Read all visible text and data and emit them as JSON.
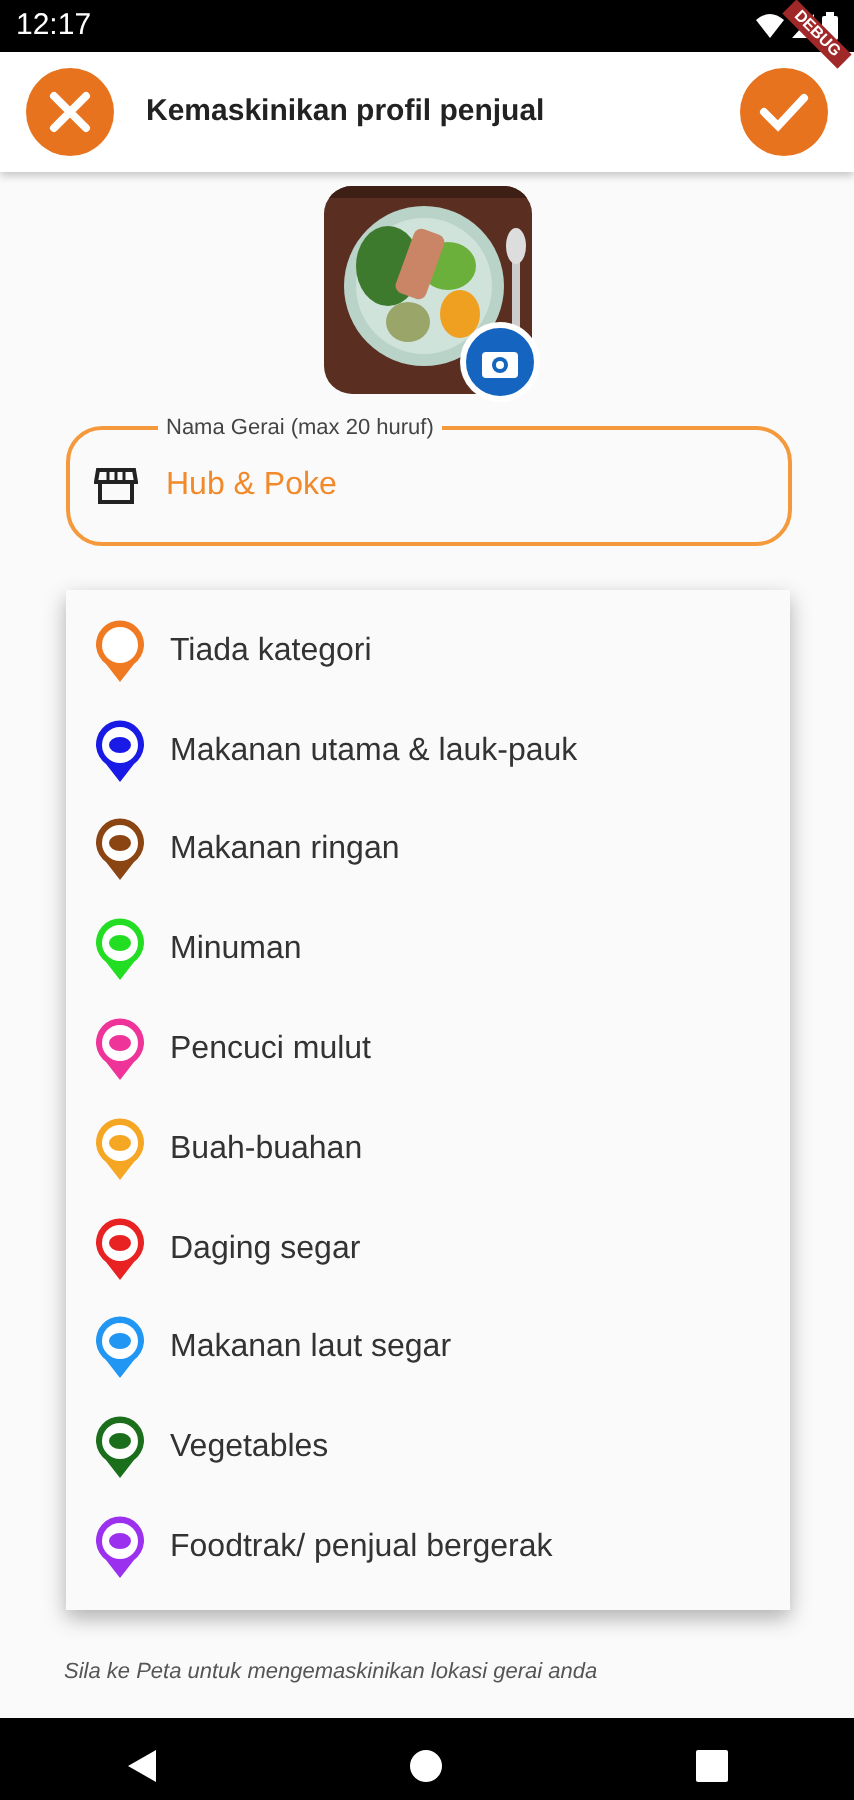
{
  "status_bar": {
    "time": "12:17"
  },
  "debug_banner": "DEBUG",
  "app_bar": {
    "title": "Kemaskinikan profil penjual"
  },
  "name_field": {
    "label": "Nama Gerai (max 20 huruf)",
    "value": "Hub & Poke"
  },
  "category_menu": [
    {
      "label": "Tiada kategori",
      "color": "#f07a22"
    },
    {
      "label": "Makanan utama & lauk-pauk",
      "color": "#1a1ae6"
    },
    {
      "label": "Makanan ringan",
      "color": "#8b4513"
    },
    {
      "label": "Minuman",
      "color": "#22dd22"
    },
    {
      "label": "Pencuci mulut",
      "color": "#ee3399"
    },
    {
      "label": "Buah-buahan",
      "color": "#f5a623"
    },
    {
      "label": "Daging segar",
      "color": "#e82222"
    },
    {
      "label": "Makanan laut segar",
      "color": "#2196f3"
    },
    {
      "label": "Vegetables",
      "color": "#1b6e1b"
    },
    {
      "label": "Foodtrak/ penjual bergerak",
      "color": "#9b30ef"
    }
  ],
  "hint": "Sila ke Peta untuk mengemaskinikan lokasi gerai anda"
}
